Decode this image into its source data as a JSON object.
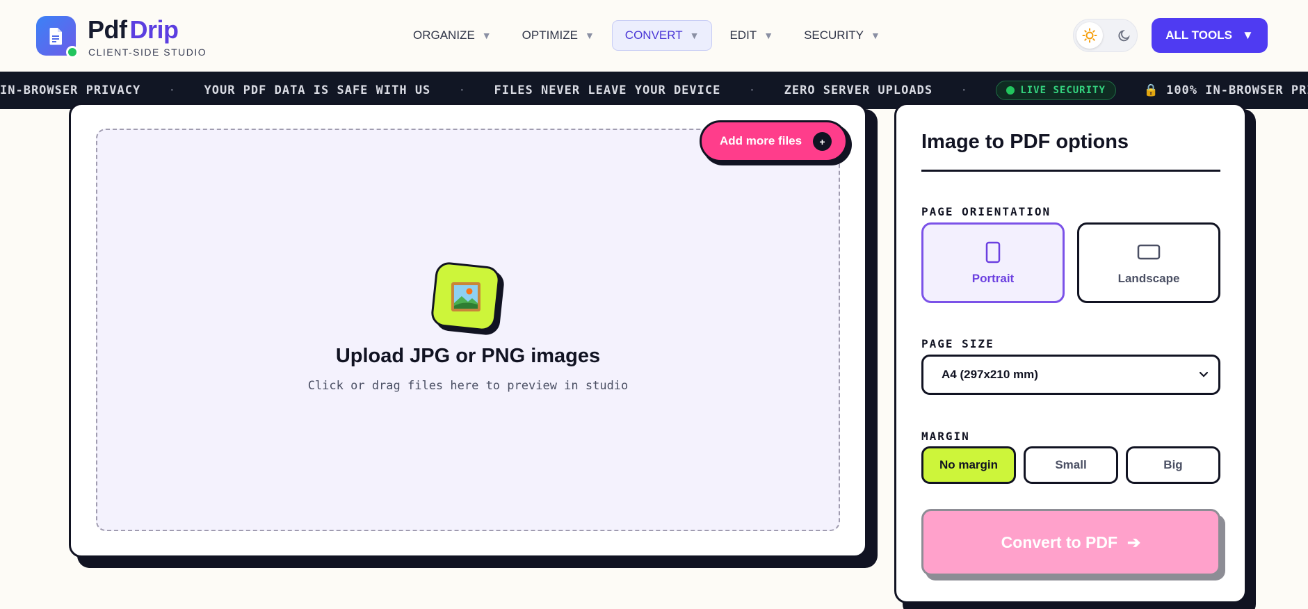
{
  "brand": {
    "name_part1": "Pdf",
    "name_part2": "Drip",
    "subtitle": "CLIENT-SIDE STUDIO"
  },
  "nav": [
    {
      "label": "ORGANIZE",
      "caret": "▼"
    },
    {
      "label": "OPTIMIZE",
      "caret": "▼"
    },
    {
      "label": "CONVERT",
      "caret": "▼",
      "active": true
    },
    {
      "label": "EDIT",
      "caret": "▼"
    },
    {
      "label": "SECURITY",
      "caret": "▼"
    }
  ],
  "header": {
    "all_tools_label": "ALL TOOLS",
    "all_tools_caret": "▼"
  },
  "ticker": {
    "items": [
      "IN-BROWSER PRIVACY",
      "YOUR PDF DATA IS SAFE WITH US",
      "FILES NEVER LEAVE YOUR DEVICE",
      "ZERO SERVER UPLOADS"
    ],
    "separator": "·",
    "live_badge": "LIVE SECURITY",
    "lock_icon": "🔒",
    "trailing_text": "100% IN-BROWSER PRIVA"
  },
  "upload": {
    "add_more_label": "Add more files",
    "add_more_plus": "+",
    "title": "Upload JPG or PNG images",
    "subtitle": "Click or drag files here to preview in studio"
  },
  "options": {
    "title": "Image to PDF options",
    "orientation_label": "PAGE ORIENTATION",
    "portrait_label": "Portrait",
    "landscape_label": "Landscape",
    "page_size_label": "PAGE SIZE",
    "page_size_value": "A4 (297x210 mm)",
    "margin_label": "MARGIN",
    "margins": [
      "No margin",
      "Small",
      "Big"
    ],
    "convert_label": "Convert to PDF",
    "convert_arrow": "➔"
  },
  "colors": {
    "accent": "#4f3bf2",
    "pink": "#ff3d8b",
    "lime": "#cdf53a",
    "ticker_bg": "#111624",
    "live_green": "#34d37f"
  },
  "icons": {
    "logo": "document-icon",
    "theme_light": "sun-icon",
    "theme_dark": "moon-icon",
    "upload": "framed-picture-icon",
    "portrait": "portrait-page-icon",
    "landscape": "landscape-page-icon"
  }
}
